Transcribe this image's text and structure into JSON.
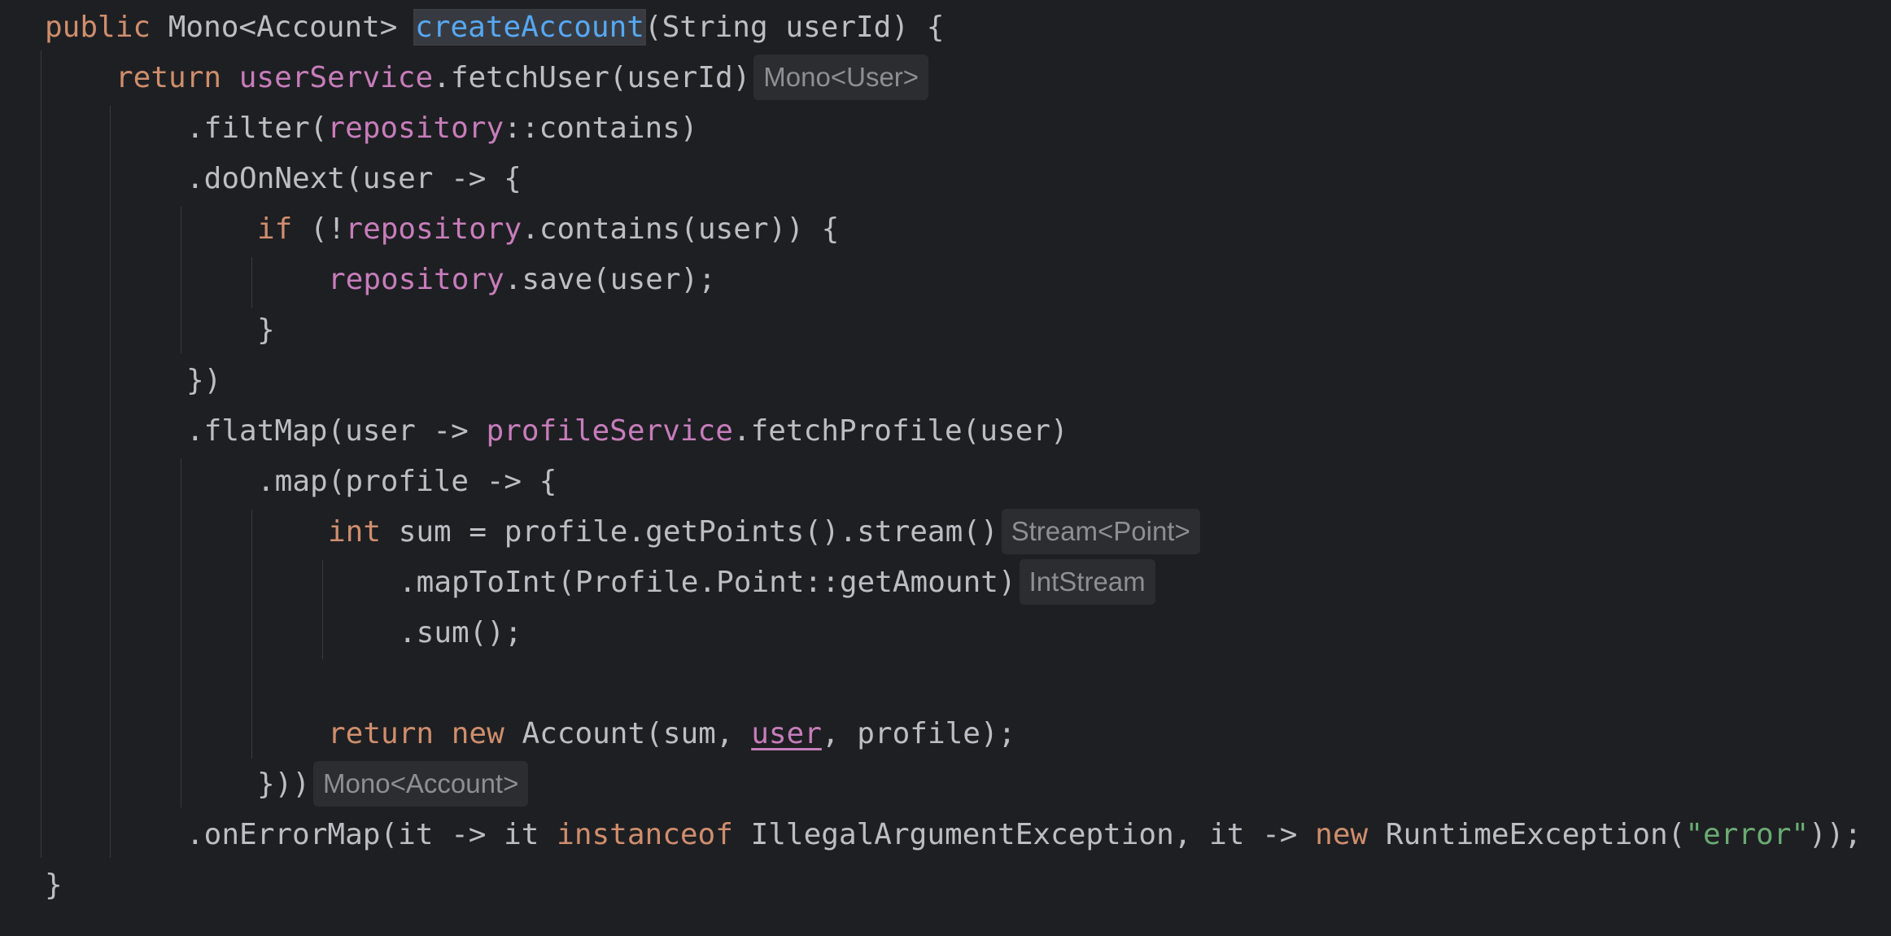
{
  "editor": {
    "theme_colors": {
      "background": "#1e1f22",
      "default_text": "#bcbec4",
      "keyword": "#cf8e6d",
      "field": "#c77dbb",
      "method_declaration": "#56a8f5",
      "string": "#6aab73",
      "inlay_hint_text": "#8c8f94",
      "inlay_hint_background": "#2b2d30"
    },
    "lines": [
      {
        "t1": "public",
        "t2": " Mono<Account> ",
        "t3": "createAccount",
        "t4": "(String userId) {"
      },
      {
        "t1": "return",
        "t2": " ",
        "t3": "userService",
        "t4": ".fetchUser(userId)",
        "hint": "Mono<User>"
      },
      {
        "t1": ".filter(",
        "t2": "repository",
        "t3": "::contains)"
      },
      {
        "t1": ".doOnNext(user -> {"
      },
      {
        "t1": "if",
        "t2": " (!",
        "t3": "repository",
        "t4": ".contains(user)) {"
      },
      {
        "t1": "repository",
        "t2": ".save(user);"
      },
      {
        "t1": "}"
      },
      {
        "t1": "})"
      },
      {
        "t1": ".flatMap(user -> ",
        "t2": "profileService",
        "t3": ".fetchProfile(user)"
      },
      {
        "t1": ".map(profile -> {"
      },
      {
        "t1": "int",
        "t2": " sum = profile.getPoints().stream()",
        "hint": "Stream<Point>"
      },
      {
        "t1": ".mapToInt(Profile.Point::getAmount)",
        "hint": "IntStream"
      },
      {
        "t1": ".sum();"
      },
      {
        "t1": "return",
        "t2": " ",
        "t3": "new",
        "t4": " Account(sum, ",
        "t5": "user",
        "t6": ", profile);"
      },
      {
        "t1": "}))",
        "hint": "Mono<Account>"
      },
      {
        "t1": ".onErrorMap(it -> it ",
        "t2": "instanceof",
        "t3": " IllegalArgumentException, it -> ",
        "t4": "new",
        "t5": " RuntimeException(",
        "t6": "\"error\"",
        "t7": "));"
      },
      {
        "t1": "}"
      }
    ]
  }
}
